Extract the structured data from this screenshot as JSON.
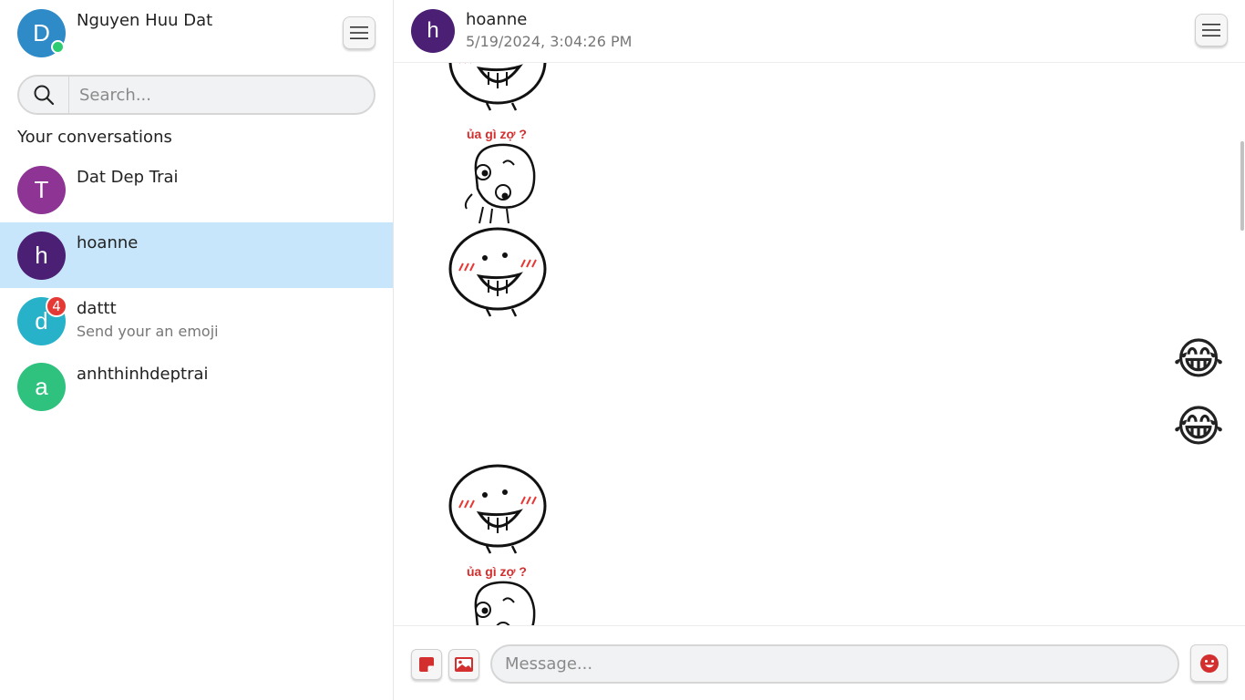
{
  "me": {
    "name": "Nguyen Huu Dat",
    "avatar_letter": "D",
    "avatar_color": "#2f8bc7",
    "online": true
  },
  "search": {
    "placeholder": "Search..."
  },
  "sidebar": {
    "section_title": "Your conversations",
    "conversations": [
      {
        "name": "Dat Dep Trai",
        "avatar_letter": "T",
        "avatar_color": "#8e3494",
        "preview": "",
        "badge": ""
      },
      {
        "name": "hoanne",
        "avatar_letter": "h",
        "avatar_color": "#4a1f74",
        "preview": "",
        "badge": "",
        "active": true
      },
      {
        "name": "dattt",
        "avatar_letter": "d",
        "avatar_color": "#27b2c9",
        "preview": "Send your an emoji",
        "badge": "4"
      },
      {
        "name": "anhthinhdeptrai",
        "avatar_letter": "a",
        "avatar_color": "#2ec27e",
        "preview": "",
        "badge": ""
      }
    ]
  },
  "chat": {
    "name": "hoanne",
    "avatar_letter": "h",
    "avatar_color": "#4a1f74",
    "timestamp": "5/19/2024, 3:04:26 PM",
    "messages": [
      {
        "type": "sticker",
        "sticker": "grin-face",
        "side": "left"
      },
      {
        "type": "sticker",
        "sticker": "confused-face",
        "side": "left",
        "caption": "ủa gì zợ ?"
      },
      {
        "type": "sticker",
        "sticker": "grin-face",
        "side": "left"
      },
      {
        "type": "emoji",
        "emoji": "😂",
        "side": "right"
      },
      {
        "type": "emoji",
        "emoji": "😂",
        "side": "right"
      },
      {
        "type": "sticker",
        "sticker": "grin-face",
        "side": "left"
      },
      {
        "type": "sticker",
        "sticker": "confused-face",
        "side": "left",
        "caption": "ủa gì zợ ?"
      }
    ]
  },
  "composer": {
    "placeholder": "Message...",
    "icons": [
      "sticker-icon",
      "image-icon",
      "emoji-icon"
    ],
    "accent_color": "#d32f2f"
  }
}
